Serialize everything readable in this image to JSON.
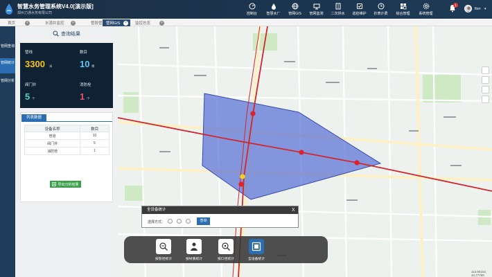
{
  "header": {
    "title": "智慧水务管理系统V4.0[演示版]",
    "subtitle": "郑州力通水务有限公司",
    "nav": [
      {
        "label": "控制台",
        "icon": "dashboard-icon"
      },
      {
        "label": "智慧水厂",
        "icon": "water-drop-icon"
      },
      {
        "label": "管网GIS",
        "icon": "globe-icon"
      },
      {
        "label": "管网监测",
        "icon": "monitor-icon"
      },
      {
        "label": "二次供水",
        "icon": "building-icon"
      },
      {
        "label": "巡检维护",
        "icon": "inspection-icon"
      },
      {
        "label": "抄表计费",
        "icon": "meter-icon"
      },
      {
        "label": "综合管理",
        "icon": "manage-icon"
      },
      {
        "label": "系统管理",
        "icon": "settings-icon"
      }
    ],
    "notification_count": "1",
    "user_name": "ltsn",
    "user_caret": "▾"
  },
  "tabs": [
    {
      "label": "首页",
      "active": false
    },
    {
      "label": "水源井监控",
      "active": false
    },
    {
      "label": "管段管理",
      "active": false
    },
    {
      "label": "管网GIS",
      "active": true
    },
    {
      "label": "监控总览",
      "active": false
    }
  ],
  "tab_close": "×",
  "side_menu": [
    {
      "label": "管网查询",
      "active": false
    },
    {
      "label": "管网统计",
      "active": true
    },
    {
      "label": "管网分析",
      "active": false
    }
  ],
  "panel": {
    "title": "查询结果",
    "stats": [
      {
        "label": "管线",
        "value": "3300",
        "unit": "米",
        "color": "#f5c518"
      },
      {
        "label": "数目",
        "value": "10",
        "unit": "根",
        "color": "#5bc8f5"
      },
      {
        "label": "阀门井",
        "value": "5",
        "unit": "个",
        "color": "#4fd1c5"
      },
      {
        "label": "消防栓",
        "value": "1",
        "unit": "个",
        "color": "#f0506e"
      }
    ],
    "list_tab": "列表数据",
    "table": {
      "headers": [
        "设备名称",
        "数目"
      ],
      "rows": [
        [
          "管道",
          "10"
        ],
        [
          "阀门井",
          "5"
        ],
        [
          "消防栓",
          "1"
        ]
      ]
    },
    "export_label": "导出分析结果"
  },
  "dialog": {
    "title": "全设备统计",
    "close": "X",
    "label": "选择方式：",
    "query_label": "查询"
  },
  "toolbar": [
    {
      "label": "按管径统计",
      "icon": "pipe-diameter-icon",
      "active": false
    },
    {
      "label": "按材质统计",
      "icon": "material-icon",
      "active": false
    },
    {
      "label": "按口径统计",
      "icon": "caliber-icon",
      "active": false
    },
    {
      "label": "全设备统计",
      "icon": "all-devices-icon",
      "active": true
    }
  ],
  "map": {
    "coordinates": "113.92104, 34.77760",
    "polygon_color": "#4a63d4",
    "pipe_color": "#d0262c",
    "node_color": "#e0202a"
  }
}
